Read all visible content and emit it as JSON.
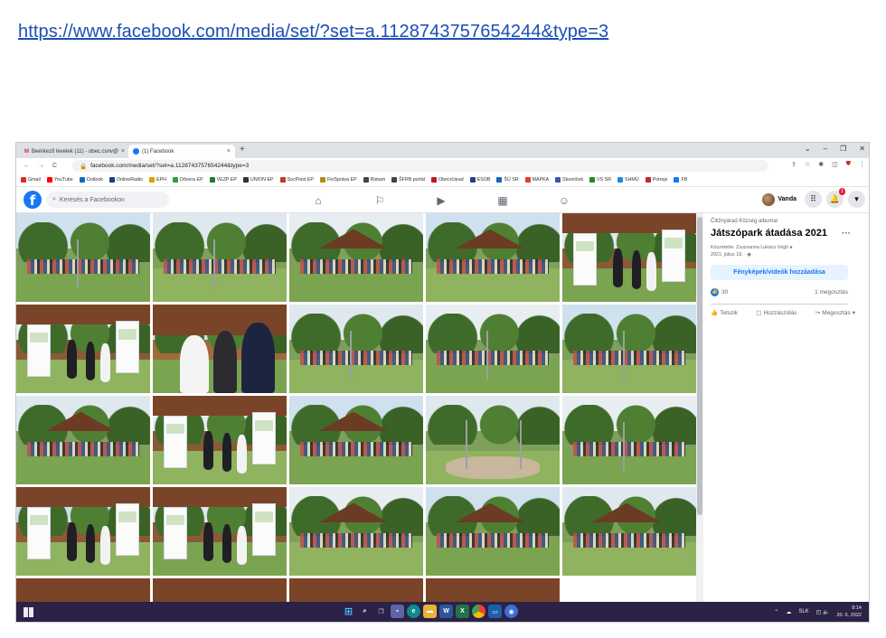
{
  "doc": {
    "link": "https://www.facebook.com/media/set/?set=a.1128743757654244&type=3"
  },
  "browser": {
    "tabs": [
      {
        "label": "Beérkező levelek (11) - obec.csnv@",
        "close": "×"
      },
      {
        "label": "(1) Facebook",
        "close": "×"
      }
    ],
    "new_tab": "+",
    "window_controls": [
      "⌄",
      "–",
      "❐",
      "✕"
    ],
    "nav": [
      "←",
      "→",
      "C"
    ],
    "url": "facebook.com/media/set/?set=a.1128743757654244&type=3",
    "bookmarks": [
      {
        "label": "Gmail",
        "color": "#d93025"
      },
      {
        "label": "YouTube",
        "color": "#ff0000"
      },
      {
        "label": "Outlook",
        "color": "#0f6cbd"
      },
      {
        "label": "OnlineRadio",
        "color": "#1e3a8a"
      },
      {
        "label": "EPH",
        "color": "#e0a100"
      },
      {
        "label": "Dôvera EP",
        "color": "#2e9e45"
      },
      {
        "label": "VEZP EP",
        "color": "#1f7a3d"
      },
      {
        "label": "UNION EP",
        "color": "#333333"
      },
      {
        "label": "SocPoist EP",
        "color": "#c0392b"
      },
      {
        "label": "FinSpráva EP",
        "color": "#b08a16"
      },
      {
        "label": "Ristam",
        "color": "#444444"
      },
      {
        "label": "ŠFRB portál",
        "color": "#444444"
      },
      {
        "label": "Obecrčárad",
        "color": "#b71c1c"
      },
      {
        "label": "ESOB",
        "color": "#2e3a87"
      },
      {
        "label": "ŠÚ SR",
        "color": "#1565c0"
      },
      {
        "label": "MAPKA",
        "color": "#e53935"
      },
      {
        "label": "Slovníček",
        "color": "#3f51b5"
      },
      {
        "label": "VS SR",
        "color": "#1b8a2f"
      },
      {
        "label": "SHMÚ",
        "color": "#1e88e5"
      },
      {
        "label": "Potreje",
        "color": "#c62828"
      },
      {
        "label": "FB",
        "color": "#1877f2"
      }
    ]
  },
  "facebook": {
    "logo": "f",
    "search_placeholder": "Keresés a Facebookon",
    "profile_name": "Vanda",
    "notification_count": "1"
  },
  "album": {
    "owner": "Čiližnyárad Község albumai",
    "title": "Játszópark átadása 2021",
    "more": "···",
    "meta_line1": "Közzétette: Zsuzsanna Lukács Végh ●",
    "meta_line2": "2021. július 18. · ◉",
    "add_button": "Fényképek/videók hozzáadása",
    "reactions": "30",
    "shares": "1 megosztás",
    "actions": {
      "like": "Tetszik",
      "comment": "Hozzászólás",
      "share": "Megosztás"
    }
  },
  "taskbar": {
    "tray_lang": "SLK",
    "time": "8:14",
    "date": "20. 6. 2022"
  }
}
